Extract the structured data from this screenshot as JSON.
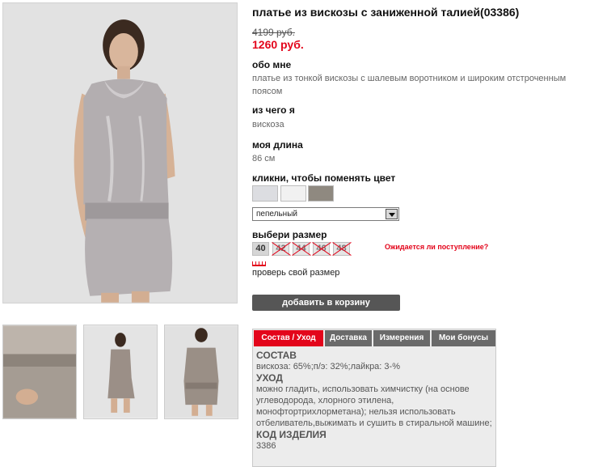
{
  "product": {
    "title": "платье из вискозы с заниженной талией(03386)",
    "old_price": "4199 руб.",
    "new_price": "1260 руб."
  },
  "about": {
    "heading": "обо мне",
    "text": "платье из тонкой вискозы с шалевым воротником и широким отстроченным поясом"
  },
  "material": {
    "heading": "из чего я",
    "text": "вискоза"
  },
  "length": {
    "heading": "моя длина",
    "text": "86 см"
  },
  "color": {
    "heading": "кликни, чтобы поменять цвет",
    "swatches": [
      "#dcdde1",
      "#f1f1f1",
      "#8f8980"
    ],
    "selected": "пепельный"
  },
  "size": {
    "heading": "выбери размер",
    "options": [
      {
        "label": "40",
        "available": true
      },
      {
        "label": "42",
        "available": false
      },
      {
        "label": "44",
        "available": false
      },
      {
        "label": "46",
        "available": false
      },
      {
        "label": "48",
        "available": false
      }
    ],
    "waiting_link": "Ожидается ли поступление?",
    "check_size": "проверь свой размер"
  },
  "cart": {
    "button": "добавить в корзину"
  },
  "tabs": {
    "items": [
      "Состав / Уход",
      "Доставка",
      "Измерения",
      "Мои бонусы"
    ],
    "active": 0,
    "content": {
      "composition_heading": "СОСТАВ",
      "composition_text": "вискоза: 65%;п/э: 32%;лайкра: 3-%",
      "care_heading": "УХОД",
      "care_text": "можно гладить, использовать химчистку (на основе углеводорода, хлорного этилена, монофтортрихлорметана); нельзя использовать отбеливатель,выжимать и сушить в стиральной машине;",
      "code_heading": "КОД ИЗДЕЛИЯ",
      "code_text": "3386"
    }
  },
  "colors": {
    "accent": "#e3051b",
    "button": "#565656",
    "tab": "#6a6a6a"
  }
}
